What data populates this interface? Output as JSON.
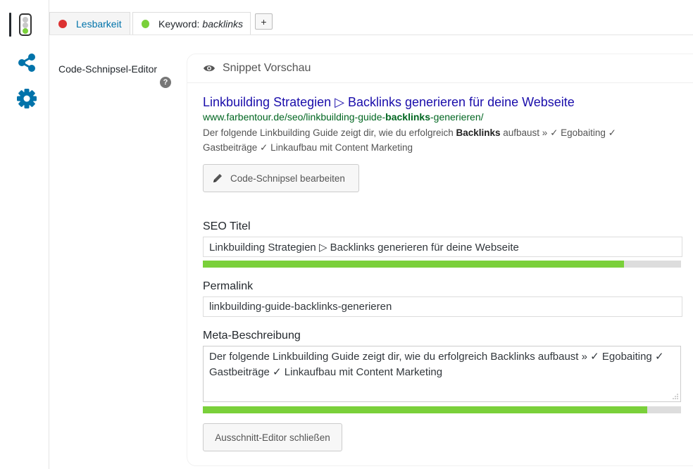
{
  "rail": {
    "icons": [
      "traffic-light-icon",
      "share-icon",
      "gear-icon"
    ]
  },
  "tabs": {
    "readability": {
      "label": "Lesbarkeit",
      "status_color": "#dc3232"
    },
    "keyword": {
      "prefix": "Keyword:",
      "keyword": "backlinks",
      "status_color": "#7ad03a"
    },
    "add_label": "+"
  },
  "editor": {
    "label": "Code-Schnipsel-Editor",
    "help_label": "?"
  },
  "preview": {
    "header": "Snippet Vorschau",
    "title": "Linkbuilding Strategien ▷ Backlinks generieren für deine Webseite",
    "url_before": "www.farbentour.de/seo/linkbuilding-guide-",
    "url_bold": "backlinks",
    "url_after": "-generieren/",
    "desc_before": "Der folgende Linkbuilding Guide zeigt dir, wie du erfolgreich ",
    "desc_bold": "Backlinks",
    "desc_after": " aufbaust » ✓ Egobaiting ✓ Gastbeiträge ✓ Linkaufbau mit Content Marketing",
    "edit_button": "Code-Schnipsel bearbeiten"
  },
  "form": {
    "seo_title_label": "SEO Titel",
    "seo_title_value": "Linkbuilding Strategien ▷ Backlinks generieren für deine Webseite",
    "seo_title_progress": 0.88,
    "permalink_label": "Permalink",
    "permalink_value": "linkbuilding-guide-backlinks-generieren",
    "meta_label": "Meta-Beschreibung",
    "meta_value": "Der folgende Linkbuilding Guide zeigt dir, wie du erfolgreich Backlinks aufbaust » ✓ Egobaiting ✓ Gastbeiträge ✓ Linkaufbau mit Content Marketing",
    "meta_progress": 0.93,
    "close_button": "Ausschnitt-Editor schließen"
  },
  "colors": {
    "progress_good": "#7ad03a",
    "link_title": "#1a0dab",
    "link_url": "#006621"
  }
}
